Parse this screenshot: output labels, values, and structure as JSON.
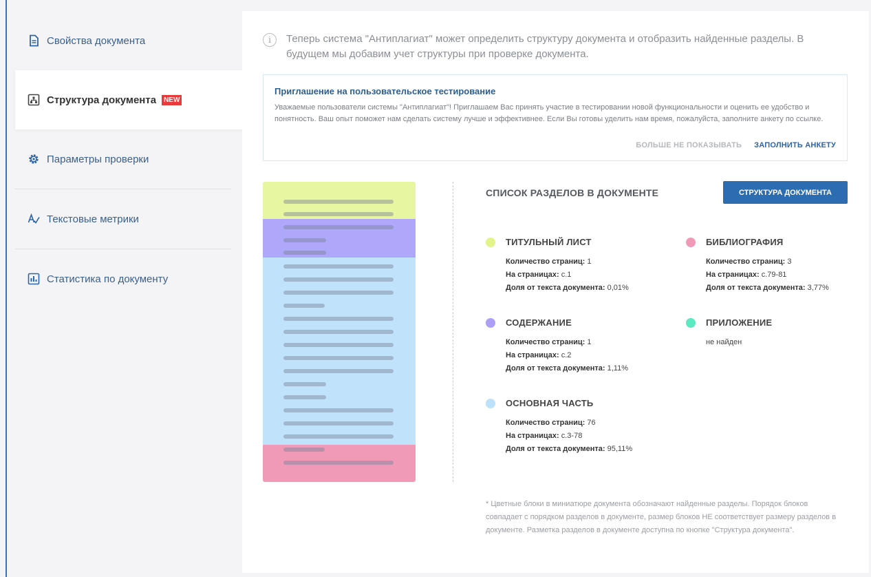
{
  "sidebar": {
    "items": [
      {
        "label": "Свойства документа",
        "icon": "document-icon"
      },
      {
        "label": "Структура документа",
        "icon": "structure-icon",
        "badge": "NEW",
        "active": true
      },
      {
        "label": "Параметры проверки",
        "icon": "gear-icon"
      },
      {
        "label": "Текстовые метрики",
        "icon": "text-metrics-icon"
      },
      {
        "label": "Статистика по документу",
        "icon": "chart-icon"
      }
    ]
  },
  "main": {
    "info_text": "Теперь система \"Антиплагиат\" может определить структуру документа и отобразить найденные разделы. В будущем мы добавим учет структуры при проверке документа.",
    "invite": {
      "title": "Приглашение на пользовательское тестирование",
      "text": "Уважаемые пользователи системы \"Антиплагиат\"! Приглашаем Вас принять участие в тестировании новой функциональности и оценить ее удобство и понятность. Ваш опыт поможет нам сделать систему лучше и эффективнее. Если Вы готовы уделить нам время, пожалуйста, заполните анкету по ссылке.",
      "dismiss_label": "БОЛЬШЕ НЕ ПОКАЗЫВАТЬ",
      "fill_label": "ЗАПОЛНИТЬ АНКЕТУ"
    },
    "list_title": "СПИСОК РАЗДЕЛОВ В ДОКУМЕНТЕ",
    "structure_button": "СТРУКТУРА ДОКУМЕНТА",
    "labels": {
      "pages_count": "Количество страниц:",
      "on_pages": "На страницах:",
      "share": "Доля от текста документа:"
    },
    "sections": {
      "title_page": {
        "name": "ТИТУЛЬНЫЙ ЛИСТ",
        "color": "#e3f58a",
        "pages": "1",
        "range": "с.1",
        "share": "0,01%"
      },
      "bibliography": {
        "name": "БИБЛИОГРАФИЯ",
        "color": "#f09ab8",
        "pages": "3",
        "range": "с.79-81",
        "share": "3,77%"
      },
      "contents": {
        "name": "СОДЕРЖАНИЕ",
        "color": "#ad9ff5",
        "pages": "1",
        "range": "с.2",
        "share": "1,11%"
      },
      "appendix": {
        "name": "ПРИЛОЖЕНИЕ",
        "color": "#5ce8c0",
        "status": "не найден"
      },
      "main_part": {
        "name": "ОСНОВНАЯ ЧАСТЬ",
        "color": "#bde0fb",
        "pages": "76",
        "range": "с.3-78",
        "share": "95,11%"
      }
    },
    "footnote": "* Цветные блоки в миниатюре документа обозначают найденные разделы. Порядок блоков совпадает с порядком разделов в документе, размер блоков НЕ соответствует размеру разделов в документе. Разметка разделов в документе доступна по кнопке \"Структура документа\"."
  },
  "colors": {
    "accent": "#2c6cb0",
    "new_badge": "#e8393b",
    "thumb_title": "#e7f6a0",
    "thumb_contents": "#afa7fa",
    "thumb_main": "#c1e2fb",
    "thumb_bibliography": "#f19ab8"
  }
}
